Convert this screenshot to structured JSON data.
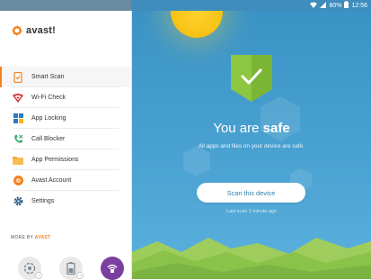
{
  "status_bar": {
    "battery": "80%",
    "time": "12:56"
  },
  "drawer": {
    "logo_text": "avast!",
    "menu": [
      {
        "label": "Smart Scan",
        "icon": "smart-scan-icon",
        "active": true
      },
      {
        "label": "Wi-Fi Check",
        "icon": "wifi-check-icon",
        "active": false
      },
      {
        "label": "App Locking",
        "icon": "app-locking-icon",
        "active": false
      },
      {
        "label": "Call Blocker",
        "icon": "call-blocker-icon",
        "active": false
      },
      {
        "label": "App Permissions",
        "icon": "folder-icon",
        "active": false
      },
      {
        "label": "Avast Account",
        "icon": "avast-account-icon",
        "active": false
      },
      {
        "label": "Settings",
        "icon": "gear-icon",
        "active": false
      }
    ],
    "more_by_prefix": "MORE BY",
    "more_by_brand": "AVAST",
    "apps": [
      "cleanup-app-icon",
      "battery-saver-app-icon",
      "secureline-app-icon"
    ]
  },
  "main": {
    "title_prefix": "You are",
    "title_emphasis": "safe",
    "subtitle": "All apps and files on your device are safe.",
    "scan_button": "Scan this device",
    "last_scan": "Last scan 1 minute ago"
  },
  "colors": {
    "accent": "#f58220",
    "sky": "#4aa2d2",
    "shield": "#8dc641",
    "hills": "#8bc34a"
  }
}
